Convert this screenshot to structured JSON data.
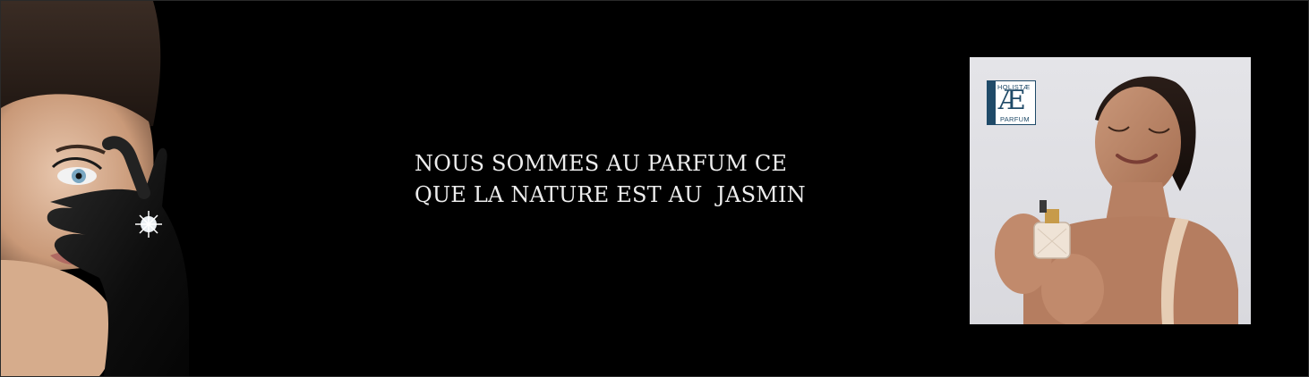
{
  "banner": {
    "slogan_line1": "NOUS SOMMES AU PARFUM CE",
    "slogan_line2": "QUE LA NATURE EST AU  JASMIN"
  },
  "logo": {
    "top_text": "HOLISTÆ",
    "mark": "Æ",
    "bottom_text": "PARFUM"
  },
  "colors": {
    "background": "#000000",
    "slogan_text": "#ededed",
    "logo_blue": "#1f4a68"
  }
}
